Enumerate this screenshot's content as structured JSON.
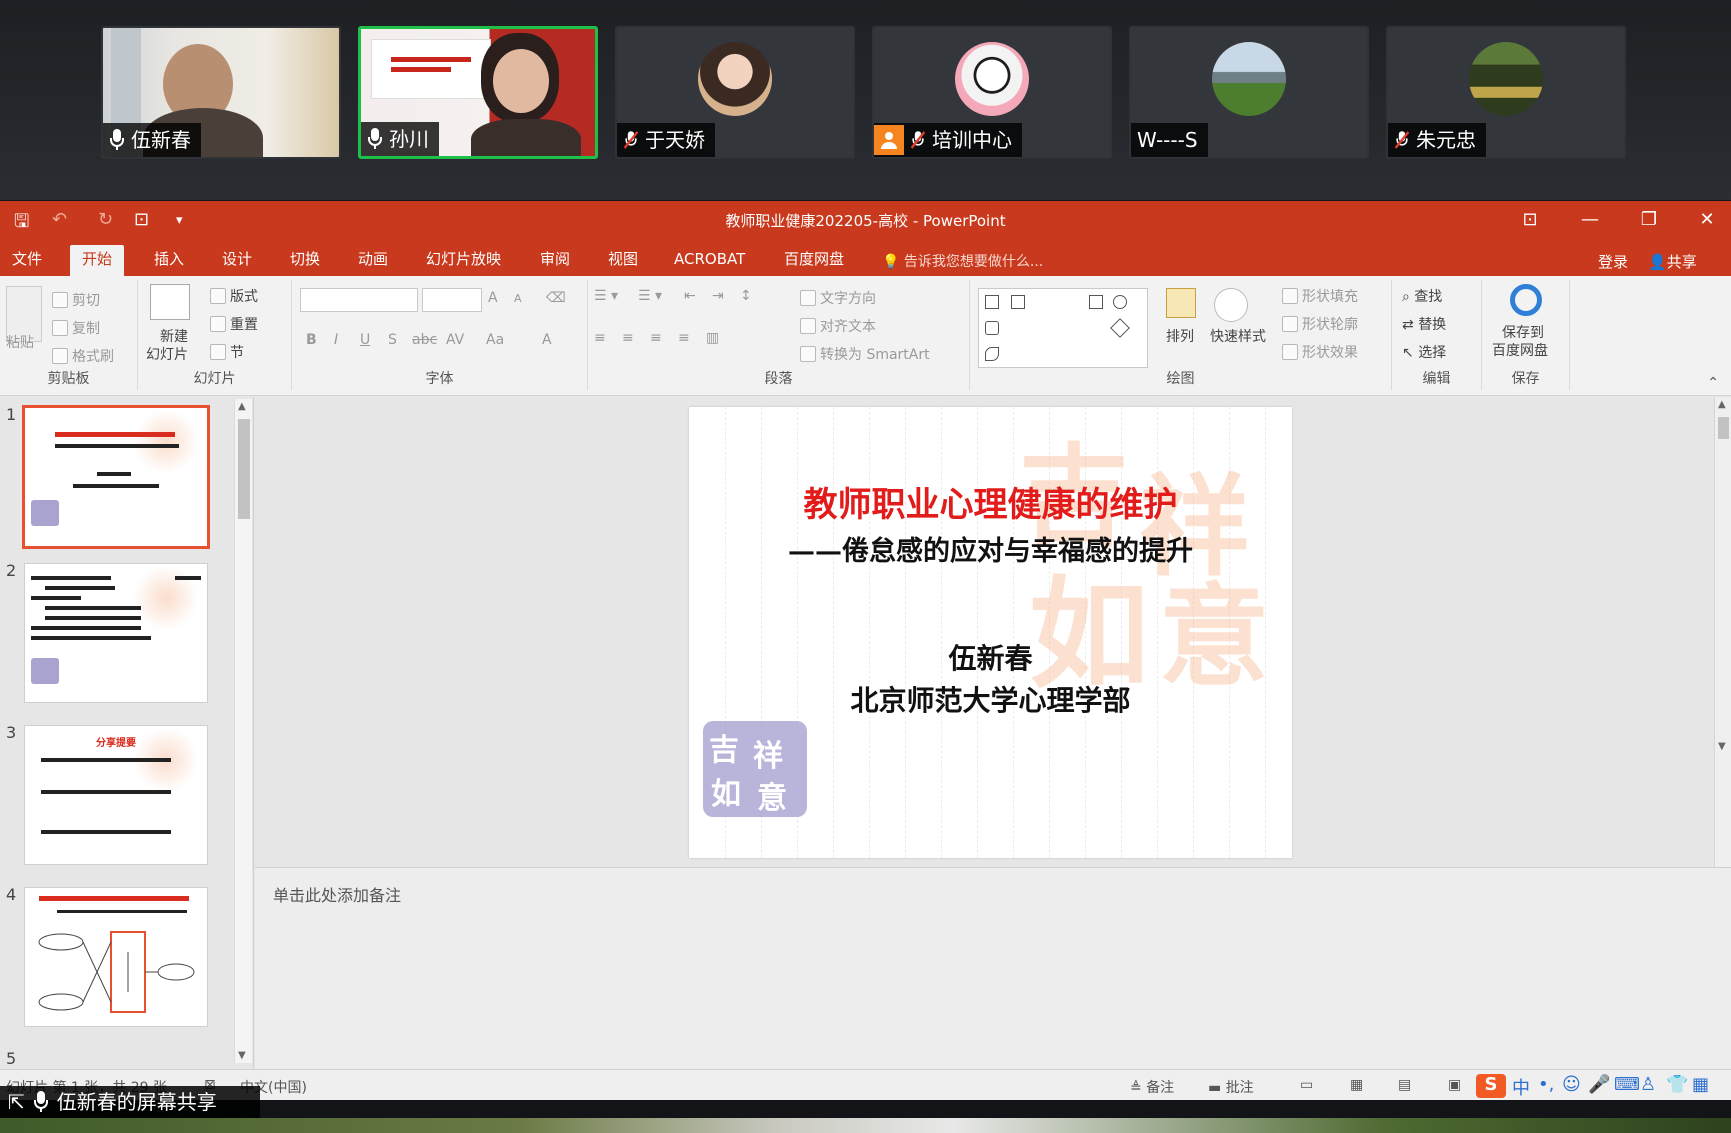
{
  "participants": [
    {
      "name": "伍新春",
      "mic": "on",
      "kind": "video"
    },
    {
      "name": "孙川",
      "mic": "on",
      "kind": "video",
      "active": true
    },
    {
      "name": "于天娇",
      "mic": "muted",
      "kind": "avatar"
    },
    {
      "name": "培训中心",
      "mic": "muted",
      "kind": "avatar",
      "badge": true
    },
    {
      "name": "W----S",
      "mic": "none",
      "kind": "avatar"
    },
    {
      "name": "朱元忠",
      "mic": "muted",
      "kind": "avatar"
    }
  ],
  "window": {
    "title": "教师职业健康202205-高校 - PowerPoint",
    "minimize": "—",
    "restore": "❐",
    "close": "✕",
    "ribbon_display": "⊡"
  },
  "tabs": [
    {
      "label": "文件"
    },
    {
      "label": "开始"
    },
    {
      "label": "插入"
    },
    {
      "label": "设计"
    },
    {
      "label": "切换"
    },
    {
      "label": "动画"
    },
    {
      "label": "幻灯片放映"
    },
    {
      "label": "审阅"
    },
    {
      "label": "视图"
    },
    {
      "label": "ACROBAT"
    },
    {
      "label": "百度网盘"
    }
  ],
  "tell_me": "告诉我您想要做什么...",
  "signin": "登录",
  "share_btn": "共享",
  "ribbon": {
    "clipboard": {
      "paste": "粘贴",
      "cut": "剪切",
      "copy": "复制",
      "format_painter": "格式刷",
      "label": "剪贴板"
    },
    "slides": {
      "new_slide_1": "新建",
      "new_slide_2": "幻灯片",
      "layout": "版式",
      "reset": "重置",
      "section": "节",
      "label": "幻灯片"
    },
    "font": {
      "bold": "B",
      "italic": "I",
      "underline": "U",
      "shadow": "S",
      "strike": "abc",
      "spacing": "AV",
      "case": "Aa",
      "color": "A",
      "grow": "A",
      "shrink": "A",
      "label": "字体"
    },
    "paragraph": {
      "text_direction": "文字方向",
      "align_text": "对齐文本",
      "smartart": "转换为 SmartArt",
      "label": "段落"
    },
    "drawing": {
      "arrange": "排列",
      "quick_styles": "快速样式",
      "shape_fill": "形状填充",
      "shape_outline": "形状轮廓",
      "shape_effects": "形状效果",
      "label": "绘图"
    },
    "editing": {
      "find": "查找",
      "replace": "替换",
      "select": "选择",
      "label": "编辑"
    },
    "save": {
      "save_to_1": "保存到",
      "save_to_2": "百度网盘",
      "label": "保存"
    }
  },
  "thumbnails": [
    {
      "number": "1",
      "selected": true
    },
    {
      "number": "2"
    },
    {
      "number": "3",
      "title": "分享提要"
    },
    {
      "number": "4"
    },
    {
      "number": "5"
    }
  ],
  "slide": {
    "title": "教师职业心理健康的维护",
    "subtitle": "——倦怠感的应对与幸福感的提升",
    "author": "伍新春",
    "department": "北京师范大学心理学部",
    "watermark": "吉祥如意"
  },
  "notes_placeholder": "单击此处添加备注",
  "status": {
    "slide_info": "幻灯片 第 1 张，共 29 张",
    "language": "中文(中国)",
    "notes": "备注",
    "comments": "批注"
  },
  "screen_share_label": "伍新春的屏幕共享",
  "colors": {
    "accent": "#c8391d",
    "active_tile": "#1ec04a",
    "title_red": "#e21b1b"
  }
}
